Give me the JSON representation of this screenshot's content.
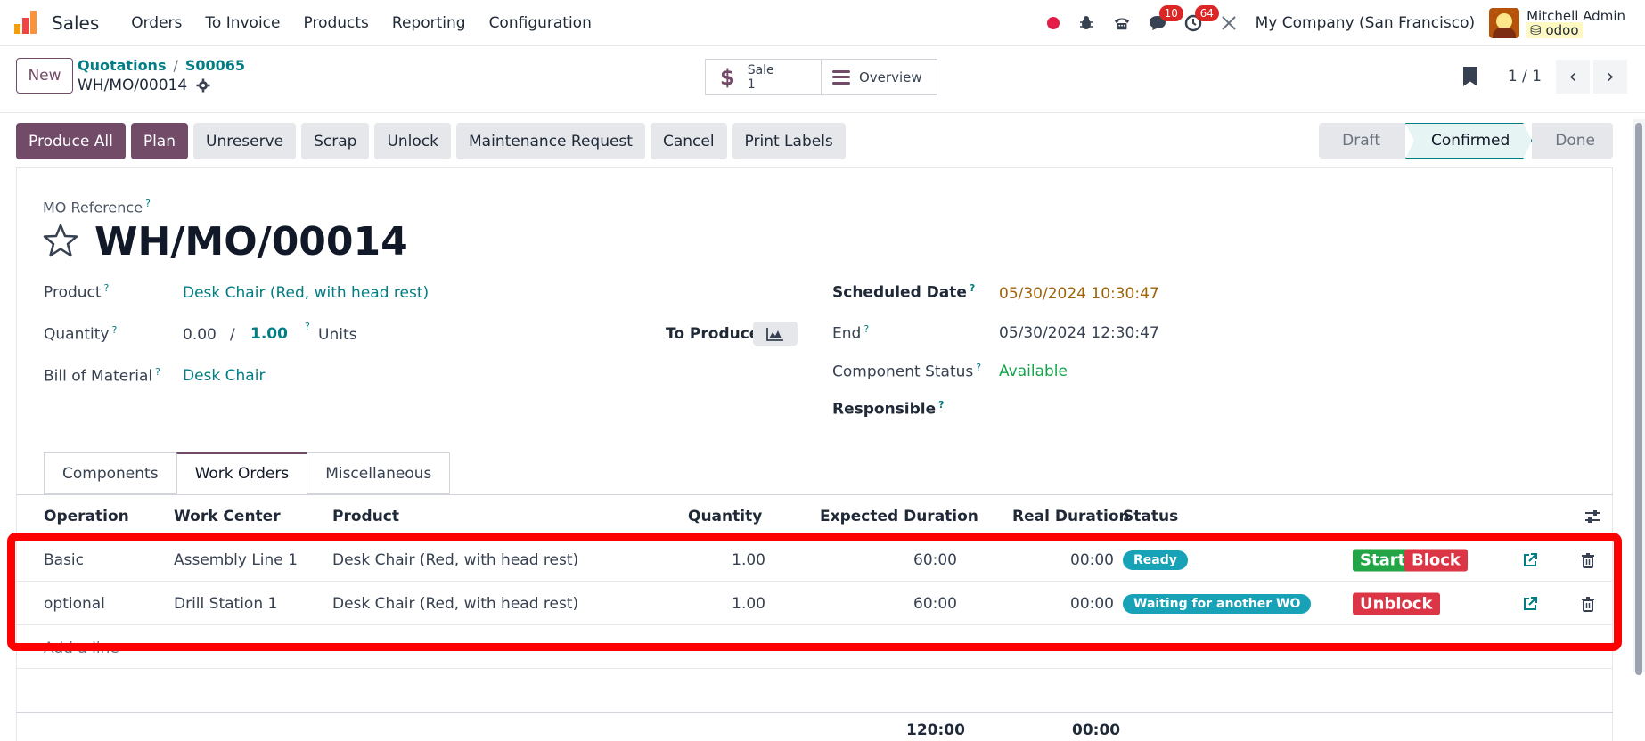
{
  "nav": {
    "app_name": "Sales",
    "menu": [
      "Orders",
      "To Invoice",
      "Products",
      "Reporting",
      "Configuration"
    ],
    "messages_count": "10",
    "activities_count": "64",
    "company": "My Company (San Francisco)",
    "user_name": "Mitchell Admin",
    "database": "odoo"
  },
  "control": {
    "new_label": "New",
    "breadcrumb": [
      "Quotations",
      "S00065"
    ],
    "record": "WH/MO/00014",
    "smart_sale_label": "Sale",
    "smart_sale_count": "1",
    "smart_overview": "Overview",
    "pager": "1 / 1"
  },
  "actions": [
    "Produce All",
    "Plan",
    "Unreserve",
    "Scrap",
    "Unlock",
    "Maintenance Request",
    "Cancel",
    "Print Labels"
  ],
  "stages": [
    "Draft",
    "Confirmed",
    "Done"
  ],
  "form": {
    "ref_label": "MO Reference",
    "title": "WH/MO/00014",
    "product_label": "Product",
    "product_value": "Desk Chair (Red, with head rest)",
    "quantity_label": "Quantity",
    "qty_produced": "0.00",
    "qty_sep": "/",
    "qty_total": "1.00",
    "uom": "Units",
    "bom_label": "Bill of Material",
    "bom_value": "Desk Chair",
    "to_produce_label": "To Produce",
    "scheduled_label": "Scheduled Date",
    "scheduled_value": "05/30/2024 10:30:47",
    "end_label": "End",
    "end_value": "05/30/2024 12:30:47",
    "component_status_label": "Component Status",
    "component_status_value": "Available",
    "responsible_label": "Responsible"
  },
  "tabs": [
    "Components",
    "Work Orders",
    "Miscellaneous"
  ],
  "table": {
    "headers": [
      "Operation",
      "Work Center",
      "Product",
      "Quantity",
      "Expected Duration",
      "Real Duration",
      "Status"
    ],
    "rows": [
      {
        "operation": "Basic",
        "work_center": "Assembly Line 1",
        "product": "Desk Chair (Red, with head rest)",
        "quantity": "1.00",
        "expected": "60:00",
        "real": "00:00",
        "status": "Ready",
        "btn1": "Start",
        "btn2": "Block"
      },
      {
        "operation": "optional",
        "work_center": "Drill Station 1",
        "product": "Desk Chair (Red, with head rest)",
        "quantity": "1.00",
        "expected": "60:00",
        "real": "00:00",
        "status": "Waiting for another WO",
        "btn1": "Unblock"
      }
    ],
    "add_line": "Add a line",
    "total_expected": "120:00",
    "total_real": "00:00"
  },
  "colors": {
    "brand": "#714b67",
    "link": "#017e84",
    "highlight": "#ff0000"
  }
}
